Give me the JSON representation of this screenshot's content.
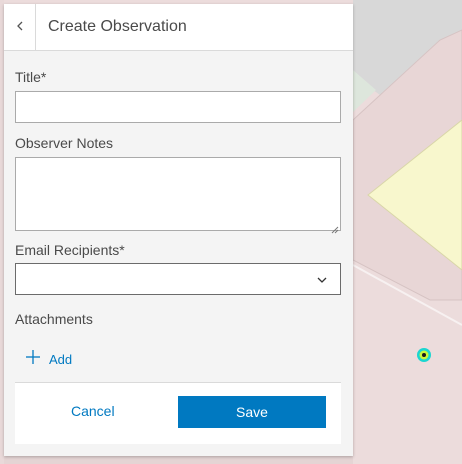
{
  "panel": {
    "title": "Create Observation",
    "back_icon": "chevron-left-icon"
  },
  "form": {
    "title_label": "Title*",
    "title_value": "",
    "notes_label": "Observer Notes",
    "notes_value": "",
    "email_label": "Email Recipients*",
    "email_selected": "",
    "attachments_label": "Attachments",
    "add_label": "Add",
    "add_icon": "plus-icon",
    "dropdown_icon": "chevron-down-icon"
  },
  "footer": {
    "cancel_label": "Cancel",
    "save_label": "Save"
  },
  "colors": {
    "accent": "#0079c1",
    "map_marker": "#1bd6d0",
    "map_parcel_yellow": "#f8f7cd",
    "map_background": "#ecdcdc"
  }
}
